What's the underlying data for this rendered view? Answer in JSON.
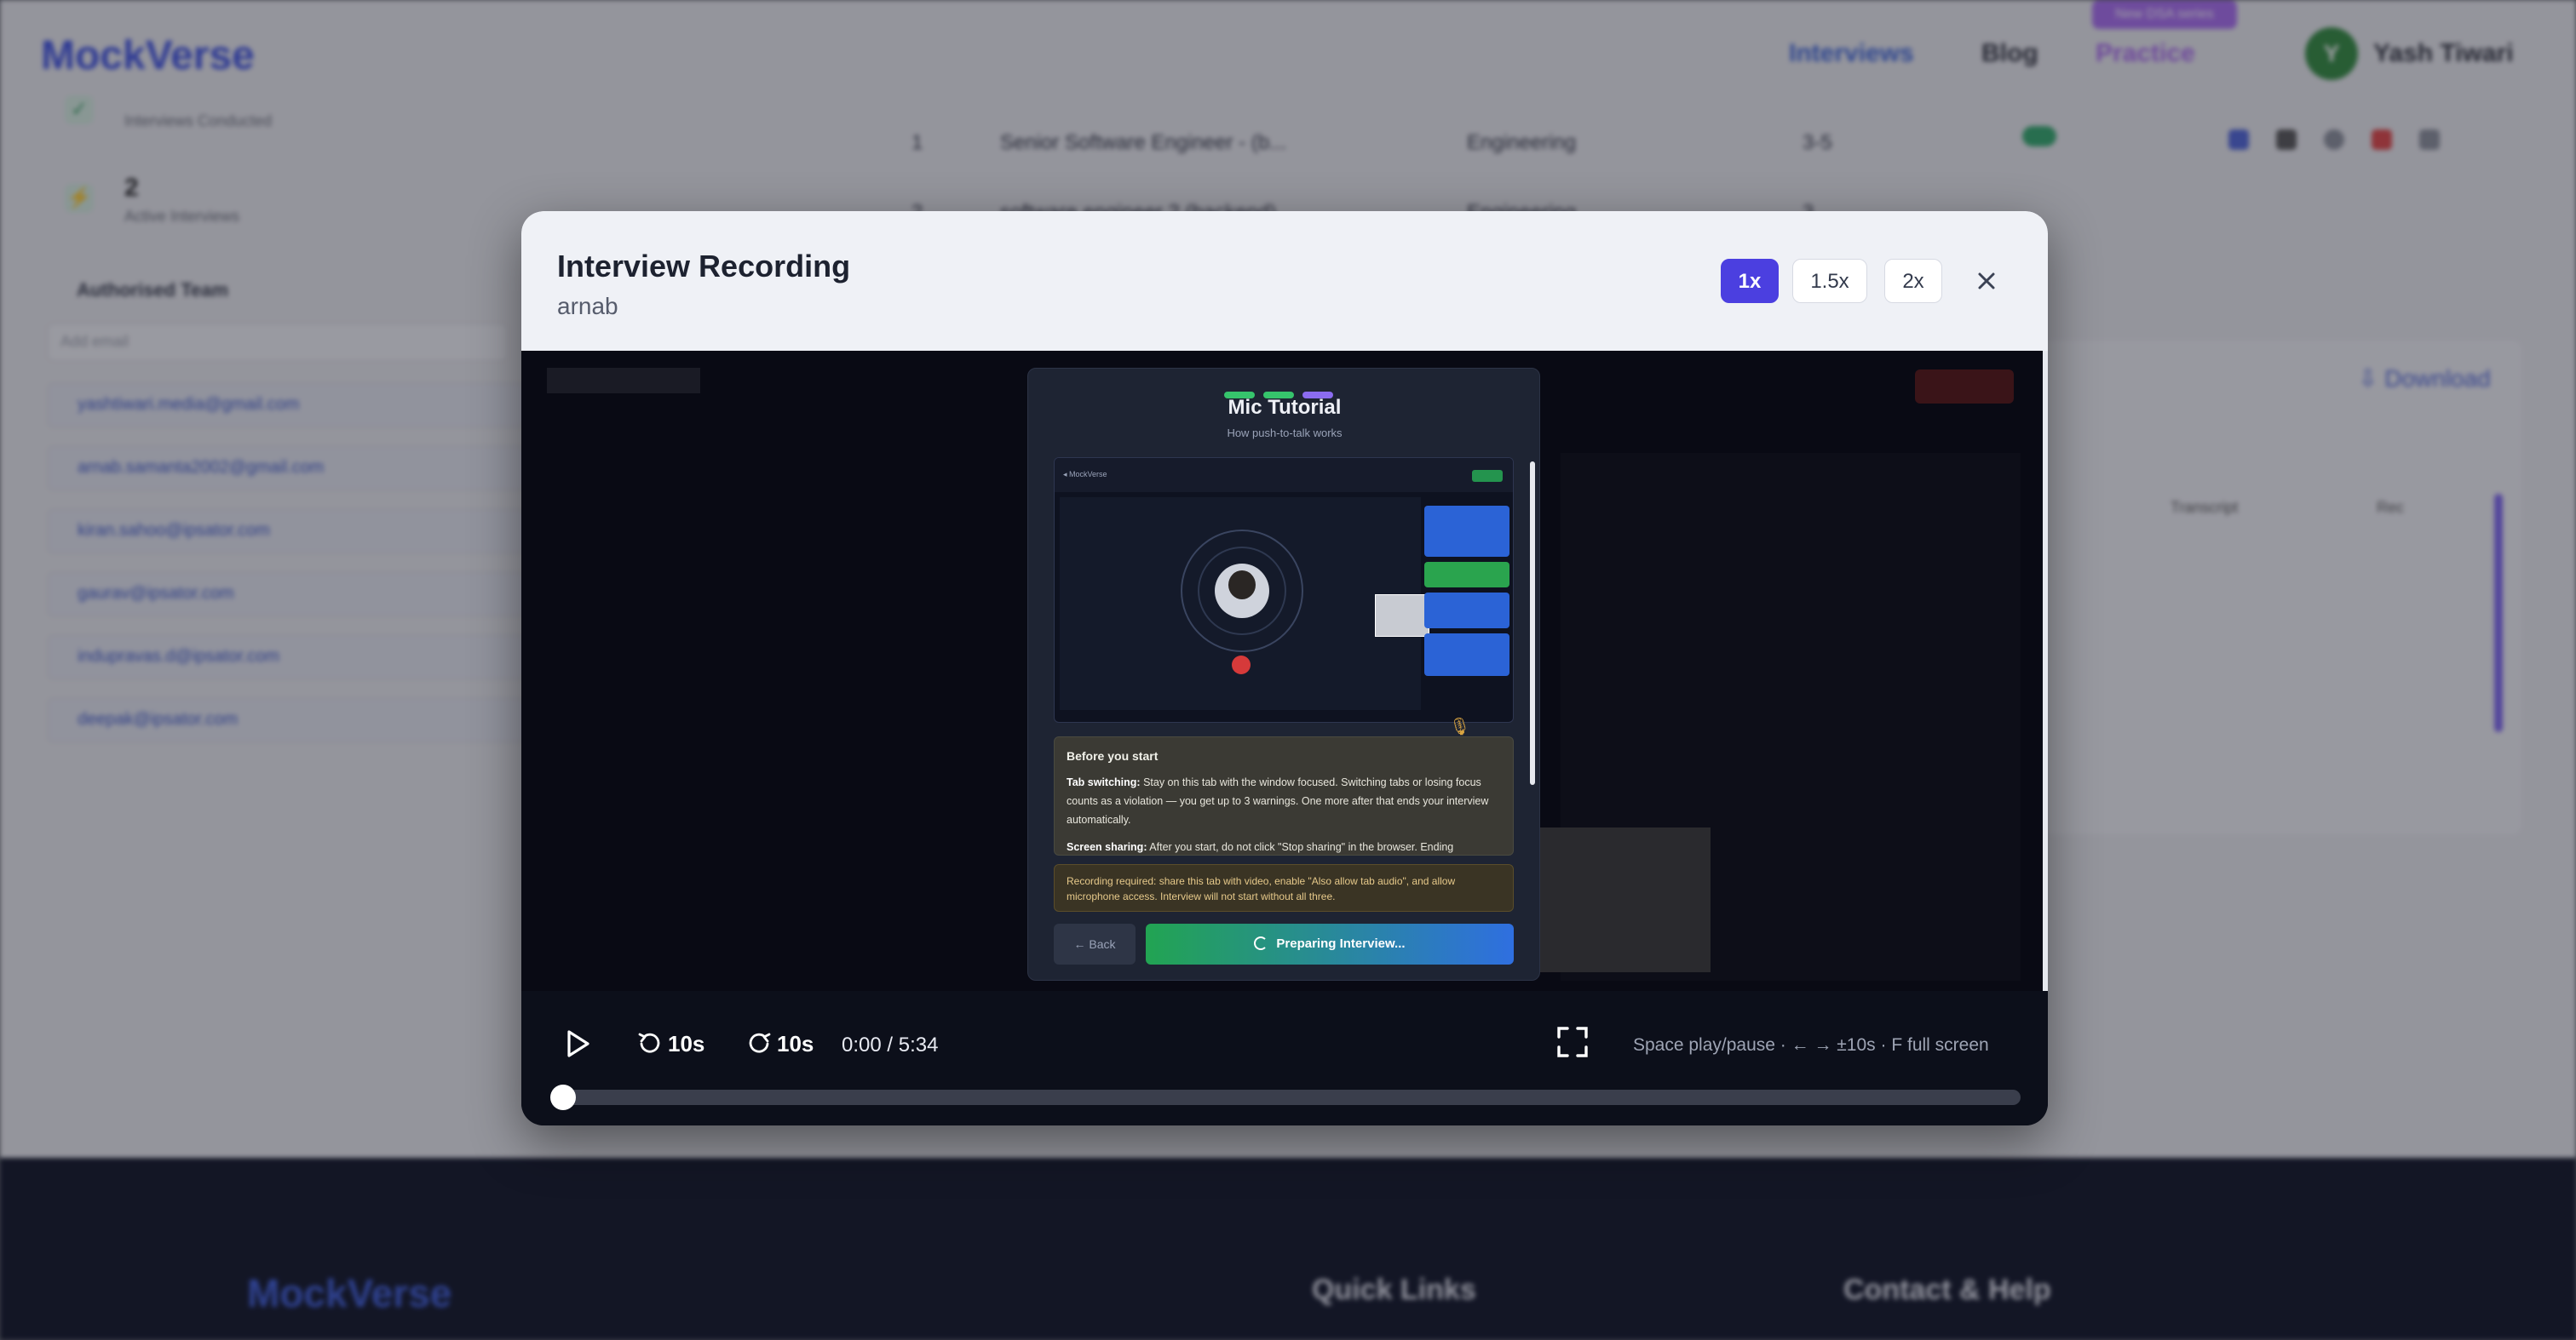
{
  "background": {
    "logo": "MockVerse",
    "nav": [
      "Interviews",
      "Blog",
      "Practice"
    ],
    "nav_badge": "New DSA series",
    "user_initial": "Y",
    "user_name": "Yash Tiwari",
    "stats": [
      {
        "value": "",
        "label": "Interviews Conducted"
      },
      {
        "value": "2",
        "label": "Active Interviews"
      }
    ],
    "team_title": "Authorised Team",
    "team_input_placeholder": "Add email",
    "team_emails": [
      "yashtiwari.media@gmail.com",
      "arnab.samanta2002@gmail.com",
      "kiran.sahoo@ipsator.com",
      "gaurav@ipsator.com",
      "indupravas.d@ipsator.com",
      "deepak@ipsator.com"
    ],
    "table_rows": [
      {
        "num": "1",
        "title": "Senior Software Engineer - (b...",
        "dept": "Engineering",
        "exp": "3-5"
      },
      {
        "num": "2",
        "title": "software engineer 2 (backend)",
        "dept": "Engineering",
        "exp": "3"
      }
    ],
    "download_label": "Download",
    "panel_cols": [
      "Transcript",
      "Rec"
    ],
    "footer_logo": "MockVerse",
    "footer_headings": [
      "Quick Links",
      "Contact & Help"
    ]
  },
  "modal": {
    "title": "Interview Recording",
    "subtitle": "arnab",
    "speeds": [
      "1x",
      "1.5x",
      "2x"
    ],
    "active_speed": "1x"
  },
  "video_frame": {
    "title": "Mic Tutorial",
    "subtitle": "How push-to-talk works",
    "before_title": "Before you start",
    "tab_switch_label": "Tab switching:",
    "tab_switch_text": "Stay on this tab with the window focused. Switching tabs or losing focus counts as a violation — you get up to 3 warnings. One more after that ends your interview automatically.",
    "screen_share_label": "Screen sharing:",
    "screen_share_text": "After you start, do not click \"Stop sharing\" in the browser. Ending",
    "recording_notice": "Recording required: share this tab with video, enable \"Also allow tab audio\", and allow microphone access. Interview will not start without all three.",
    "back_label": "← Back",
    "preparing_label": "Preparing Interview..."
  },
  "controls": {
    "rewind_label": "10s",
    "forward_label": "10s",
    "time": "0:00 / 5:34",
    "hint": "Space play/pause · ← → ±10s · F full screen",
    "progress": 0.0
  },
  "colors": {
    "accent": "#4b3fe0",
    "video_bg": "#070812",
    "header_bg": "#eff1f6"
  },
  "icons": {
    "play": "play-icon",
    "rewind": "rewind-icon",
    "forward": "forward-icon",
    "fullscreen": "fullscreen-icon",
    "close": "close-icon"
  }
}
